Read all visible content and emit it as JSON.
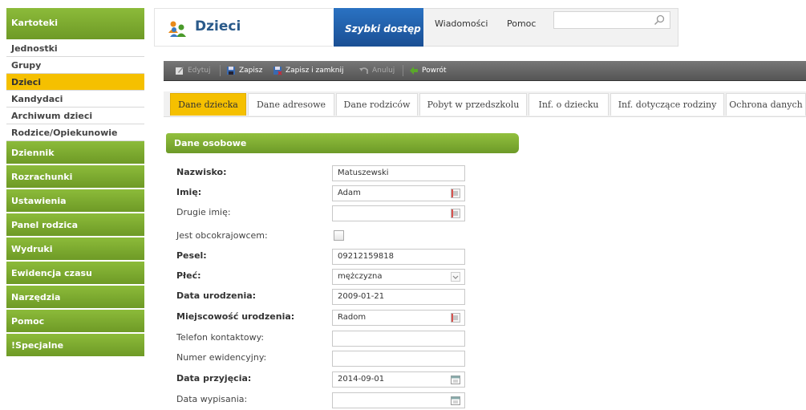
{
  "sidebar": {
    "head": "Kartoteki",
    "subitems": [
      {
        "label": "Jednostki"
      },
      {
        "label": "Grupy"
      },
      {
        "label": "Dzieci"
      },
      {
        "label": "Kandydaci"
      },
      {
        "label": "Archiwum dzieci"
      },
      {
        "label": "Rodzice/Opiekunowie"
      }
    ],
    "groups": [
      {
        "label": "Dziennik"
      },
      {
        "label": "Rozrachunki"
      },
      {
        "label": "Ustawienia"
      },
      {
        "label": "Panel rodzica"
      },
      {
        "label": "Wydruki"
      },
      {
        "label": "Ewidencja czasu"
      },
      {
        "label": "Narzędzia"
      },
      {
        "label": "Pomoc"
      },
      {
        "label": "!Specjalne"
      }
    ]
  },
  "header": {
    "title": "Dzieci",
    "quick_access": "Szybki dostęp",
    "messages": "Wiadomości",
    "help": "Pomoc",
    "search_value": ""
  },
  "toolbar": {
    "edit": "Edytuj",
    "save": "Zapisz",
    "save_close": "Zapisz i zamknij",
    "cancel": "Anuluj",
    "back": "Powrót"
  },
  "tabs": [
    {
      "label": "Dane dziecka"
    },
    {
      "label": "Dane adresowe"
    },
    {
      "label": "Dane rodziców"
    },
    {
      "label": "Pobyt w przedszkolu"
    },
    {
      "label": "Inf. o dziecku"
    },
    {
      "label": "Inf. dotyczące rodziny"
    },
    {
      "label": "Ochrona danych"
    }
  ],
  "section": {
    "title": "Dane osobowe"
  },
  "form": {
    "surname": {
      "label": "Nazwisko:",
      "value": "Matuszewski"
    },
    "first_name": {
      "label": "Imię:",
      "value": "Adam"
    },
    "second_name": {
      "label": "Drugie imię:",
      "value": ""
    },
    "foreigner": {
      "label": "Jest obcokrajowcem:"
    },
    "pesel": {
      "label": "Pesel:",
      "value": "09212159818"
    },
    "gender": {
      "label": "Płeć:",
      "value": "mężczyzna"
    },
    "birth_date": {
      "label": "Data urodzenia:",
      "value": "2009-01-21"
    },
    "birth_place": {
      "label": "Miejscowość urodzenia:",
      "value": "Radom"
    },
    "phone": {
      "label": "Telefon kontaktowy:",
      "value": ""
    },
    "record_number": {
      "label": "Numer ewidencyjny:",
      "value": ""
    },
    "admission_date": {
      "label": "Data przyjęcia:",
      "value": "2014-09-01"
    },
    "discharge_date": {
      "label": "Data wypisania:",
      "value": ""
    }
  }
}
